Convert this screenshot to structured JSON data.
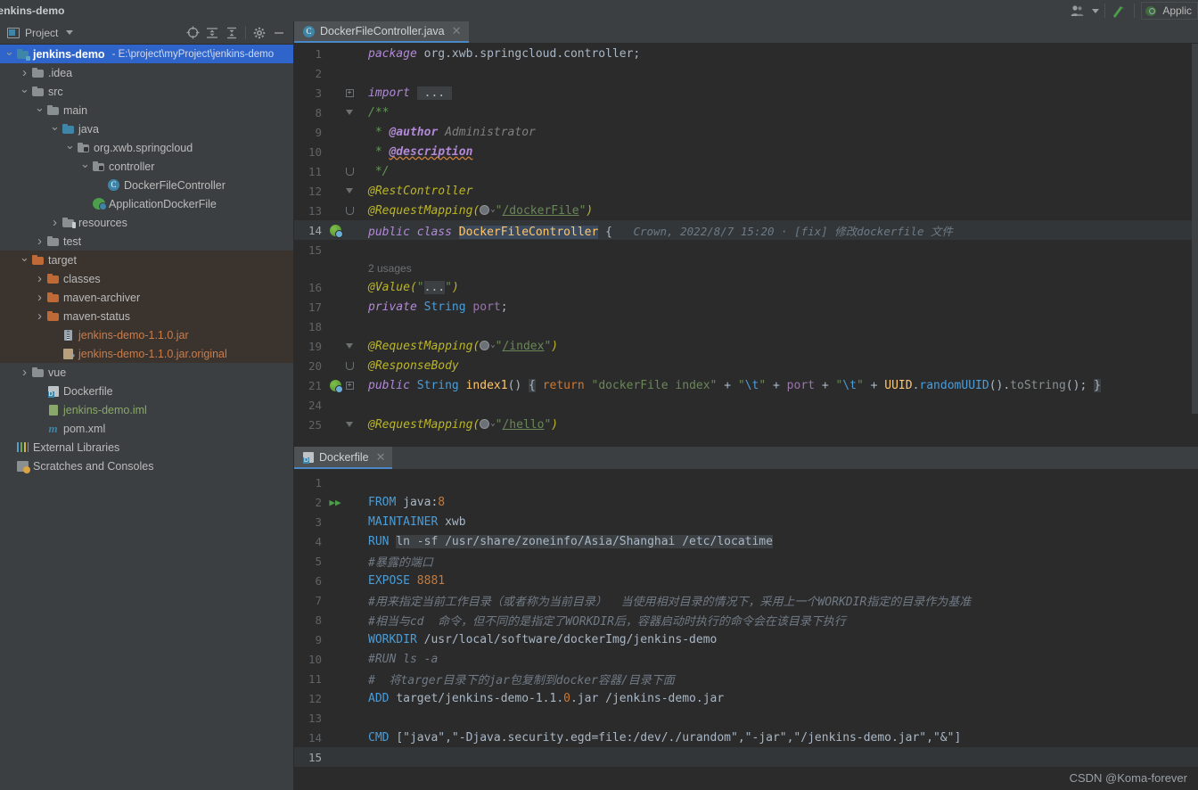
{
  "window": {
    "title": "jenkins-demo"
  },
  "titlebar": {
    "user_icon": "users-icon",
    "updates_icon": "green-arrow-up-icon",
    "run_config_label": "Applic",
    "run_config_icon": "spring-boot-icon"
  },
  "sidebar": {
    "header": {
      "label": "Project",
      "caret": "chevron-down-icon",
      "buttons": [
        {
          "name": "locate-icon",
          "glyph": "⊕"
        },
        {
          "name": "expand-all-icon",
          "glyph": "≛"
        },
        {
          "name": "collapse-all-icon",
          "glyph": "≛"
        },
        {
          "name": "settings-gear-icon",
          "glyph": "✿"
        },
        {
          "name": "hide-icon",
          "glyph": "—"
        }
      ]
    },
    "tree": [
      {
        "label": "jenkins-demo",
        "sub": "- E:\\project\\myProject\\jenkins-demo",
        "indent": 0,
        "arrow": "down",
        "icon": "module-icon",
        "state": "selected"
      },
      {
        "label": ".idea",
        "indent": 1,
        "arrow": "right",
        "icon": "folder-icon",
        "color": "gray"
      },
      {
        "label": "src",
        "indent": 1,
        "arrow": "down",
        "icon": "folder-icon",
        "color": "gray"
      },
      {
        "label": "main",
        "indent": 2,
        "arrow": "down",
        "icon": "folder-icon",
        "color": "gray"
      },
      {
        "label": "java",
        "indent": 3,
        "arrow": "down",
        "icon": "source-folder-icon",
        "color": "blue"
      },
      {
        "label": "org.xwb.springcloud",
        "indent": 4,
        "arrow": "down",
        "icon": "package-icon",
        "color": "gray"
      },
      {
        "label": "controller",
        "indent": 5,
        "arrow": "down",
        "icon": "package-icon",
        "color": "gray"
      },
      {
        "label": "DockerFileController",
        "indent": 6,
        "arrow": "none",
        "icon": "java-class-icon"
      },
      {
        "label": "ApplicationDockerFile",
        "indent": 5,
        "arrow": "none",
        "icon": "spring-application-icon"
      },
      {
        "label": "resources",
        "indent": 3,
        "arrow": "right",
        "icon": "resources-folder-icon",
        "color": "gray"
      },
      {
        "label": "test",
        "indent": 2,
        "arrow": "right",
        "icon": "folder-icon",
        "color": "gray"
      },
      {
        "label": "target",
        "indent": 1,
        "arrow": "down",
        "icon": "folder-icon",
        "color": "orange",
        "state": "target"
      },
      {
        "label": "classes",
        "indent": 2,
        "arrow": "right",
        "icon": "folder-icon",
        "color": "orange",
        "state": "target"
      },
      {
        "label": "maven-archiver",
        "indent": 2,
        "arrow": "right",
        "icon": "folder-icon",
        "color": "orange",
        "state": "target"
      },
      {
        "label": "maven-status",
        "indent": 2,
        "arrow": "right",
        "icon": "folder-icon",
        "color": "orange",
        "state": "target"
      },
      {
        "label": "jenkins-demo-1.1.0.jar",
        "indent": 3,
        "arrow": "none",
        "icon": "jar-icon",
        "color": "orange-text",
        "state": "target"
      },
      {
        "label": "jenkins-demo-1.1.0.jar.original",
        "indent": 3,
        "arrow": "none",
        "icon": "jar-unknown-icon",
        "color": "orange-text",
        "state": "target"
      },
      {
        "label": "vue",
        "indent": 1,
        "arrow": "right",
        "icon": "folder-icon",
        "color": "gray"
      },
      {
        "label": "Dockerfile",
        "indent": 2,
        "arrow": "none",
        "icon": "dockerfile-icon"
      },
      {
        "label": "jenkins-demo.iml",
        "indent": 2,
        "arrow": "none",
        "icon": "iml-icon",
        "color": "green-text"
      },
      {
        "label": "pom.xml",
        "indent": 2,
        "arrow": "none",
        "icon": "maven-icon"
      },
      {
        "label": "External Libraries",
        "indent": 0,
        "arrow": "none",
        "icon": "libraries-icon"
      },
      {
        "label": "Scratches and Consoles",
        "indent": 0,
        "arrow": "none",
        "icon": "scratches-icon"
      }
    ]
  },
  "editor": {
    "tab": {
      "label": "DockerFileController.java",
      "icon": "java-class-icon",
      "close": "✕"
    },
    "vcs_annotation": "Crown, 2022/8/7 15:20 · [fix] 修改dockerfile 文件",
    "usages_hint": "2 usages",
    "lines": [
      {
        "num": "1",
        "text": "package org.xwb.springcloud.controller;"
      },
      {
        "num": "2",
        "text": ""
      },
      {
        "num": "3",
        "text": "import ..."
      },
      {
        "num": "8",
        "text": "/**"
      },
      {
        "num": "9",
        "text": " * @author Administrator"
      },
      {
        "num": "10",
        "text": " * @description"
      },
      {
        "num": "11",
        "text": " */"
      },
      {
        "num": "12",
        "text": "@RestController"
      },
      {
        "num": "13",
        "text": "@RequestMapping(\"/dockerFile\")"
      },
      {
        "num": "14",
        "text": "public class DockerFileController {"
      },
      {
        "num": "15",
        "text": ""
      },
      {
        "num": "",
        "text": "2 usages"
      },
      {
        "num": "16",
        "text": "@Value(\"...\")"
      },
      {
        "num": "17",
        "text": "private String port;"
      },
      {
        "num": "18",
        "text": ""
      },
      {
        "num": "19",
        "text": "@RequestMapping(\"/index\")"
      },
      {
        "num": "20",
        "text": "@ResponseBody"
      },
      {
        "num": "21",
        "text": "public String index1() { return \"dockerFile index\" + \"\\t\" + port + \"\\t\" + UUID.randomUUID().toString(); }"
      },
      {
        "num": "24",
        "text": ""
      },
      {
        "num": "25",
        "text": "@RequestMapping(\"/hello\")"
      }
    ]
  },
  "dockerfile": {
    "tab": {
      "label": "Dockerfile",
      "icon": "dockerfile-icon",
      "close": "✕"
    },
    "lines": [
      {
        "num": "1",
        "text": ""
      },
      {
        "num": "2",
        "text": "FROM java:8",
        "runmark": true
      },
      {
        "num": "3",
        "text": "MAINTAINER xwb"
      },
      {
        "num": "4",
        "text": "RUN ln -sf /usr/share/zoneinfo/Asia/Shanghai /etc/locatime"
      },
      {
        "num": "5",
        "text": "#暴露的端口"
      },
      {
        "num": "6",
        "text": "EXPOSE 8881"
      },
      {
        "num": "7",
        "text": "#用来指定当前工作目录（或者称为当前目录）  当使用相对目录的情况下，采用上一个WORKDIR指定的目录作为基准"
      },
      {
        "num": "8",
        "text": "#相当与cd  命令，但不同的是指定了WORKDIR后，容器启动时执行的命令会在该目录下执行"
      },
      {
        "num": "9",
        "text": "WORKDIR /usr/local/software/dockerImg/jenkins-demo"
      },
      {
        "num": "10",
        "text": "#RUN ls -a"
      },
      {
        "num": "11",
        "text": "#  将targer目录下的jar包复制到docker容器/目录下面"
      },
      {
        "num": "12",
        "text": "ADD target/jenkins-demo-1.1.0.jar /jenkins-demo.jar"
      },
      {
        "num": "13",
        "text": ""
      },
      {
        "num": "14",
        "text": "CMD [\"java\",\"-Djava.security.egd=file:/dev/./urandom\",\"-jar\",\"/jenkins-demo.jar\",\"&\"]"
      },
      {
        "num": "15",
        "text": ""
      }
    ]
  },
  "watermark": {
    "text": "CSDN @Koma-forever"
  },
  "colors": {
    "accent": "#4a88c7",
    "selection": "#2f65ca",
    "target_bg": "#3b332e",
    "editor_bg": "#2b2b2b",
    "panel_bg": "#3c3f41"
  }
}
